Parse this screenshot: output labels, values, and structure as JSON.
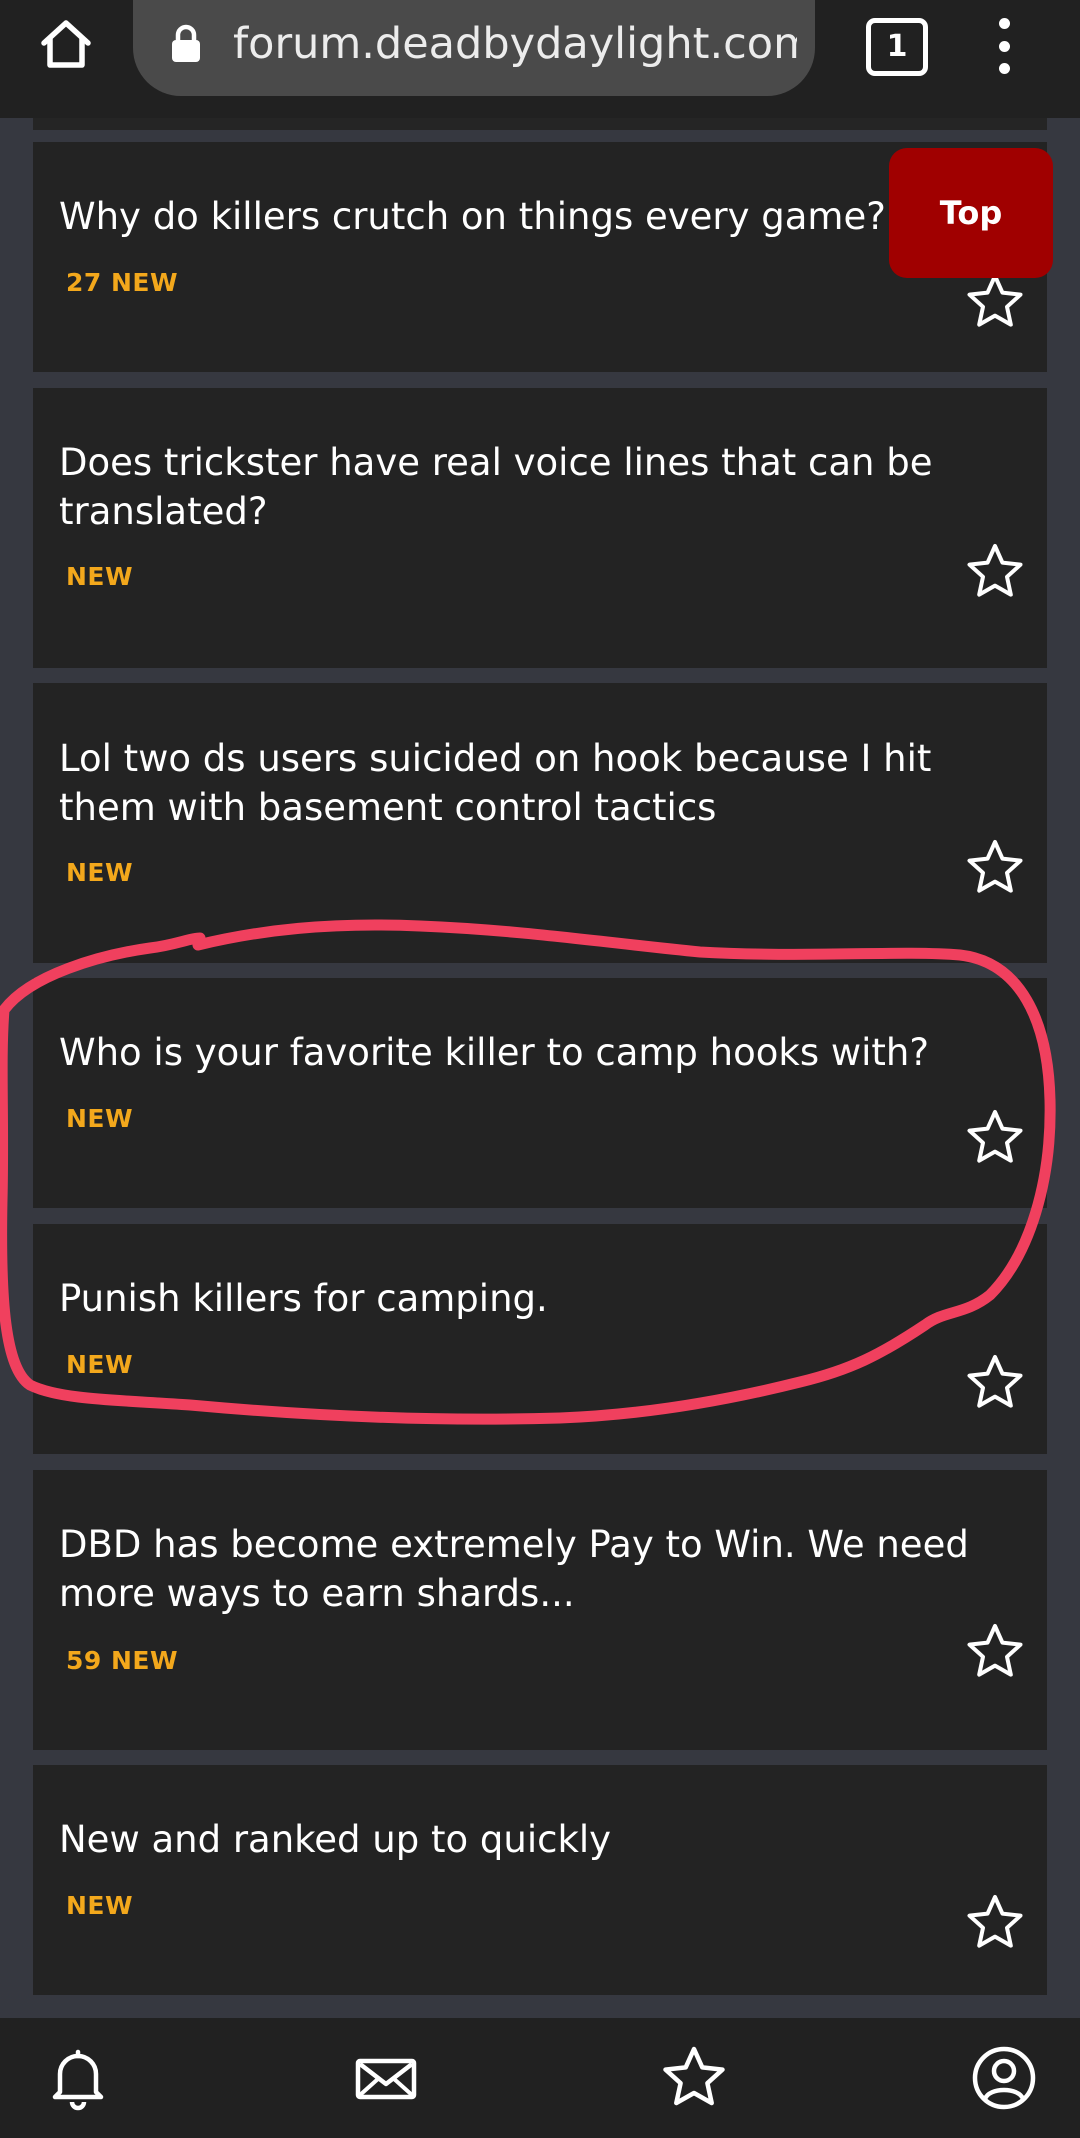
{
  "browser": {
    "url": "forum.deadbydaylight.com/e",
    "tab_count": "1"
  },
  "top_button": {
    "label": "Top",
    "color": "#a00000"
  },
  "threads": [
    {
      "title": "Why do killers crutch on things every game?",
      "badge": "27 NEW"
    },
    {
      "title": "Does trickster have real voice lines that can be translated?",
      "badge": "NEW"
    },
    {
      "title": "Lol two ds users suicided on hook because I hit them with basement control tactics",
      "badge": "NEW"
    },
    {
      "title": "Who is your favorite killer to camp hooks with?",
      "badge": "NEW"
    },
    {
      "title": "Punish killers for camping.",
      "badge": "NEW"
    },
    {
      "title": "DBD has become extremely Pay to Win. We need more ways to earn shards...",
      "badge": "59 NEW"
    },
    {
      "title": "New and ranked up to quickly",
      "badge": "NEW"
    }
  ],
  "colors": {
    "background": "#363840",
    "card": "#232323",
    "badge": "#f3a81c",
    "annotation": "#f0405e"
  },
  "icons": {
    "home": "home-icon",
    "lock": "lock-icon",
    "menu": "more-vert-icon",
    "star": "star-outline-icon",
    "notifications": "bell-icon",
    "messages": "envelope-icon",
    "bookmarks": "star-icon",
    "profile": "user-circle-icon"
  }
}
